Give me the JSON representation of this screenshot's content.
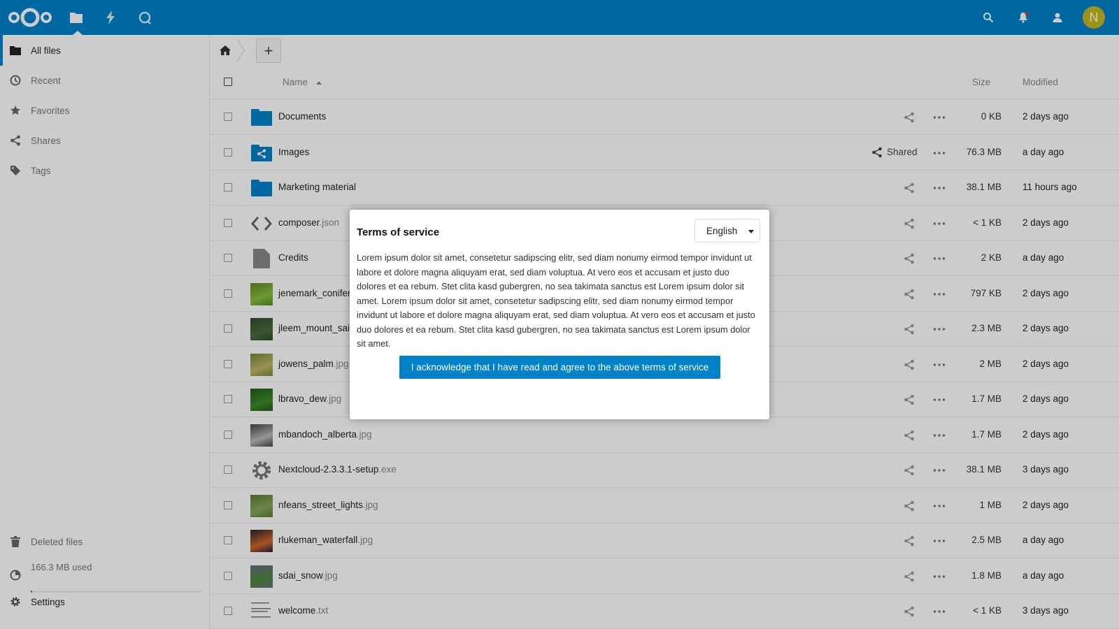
{
  "header": {
    "apps": [
      "files-app",
      "activity-app",
      "talk-app"
    ],
    "avatar_initial": "N",
    "accent_color": "#0082c9"
  },
  "sidebar": {
    "items": [
      {
        "label": "All files",
        "icon": "folder-icon"
      },
      {
        "label": "Recent",
        "icon": "clock-icon"
      },
      {
        "label": "Favorites",
        "icon": "star-icon"
      },
      {
        "label": "Shares",
        "icon": "share-icon"
      },
      {
        "label": "Tags",
        "icon": "tag-icon"
      }
    ],
    "deleted_files": "Deleted files",
    "quota": "166.3 MB used",
    "settings": "Settings"
  },
  "table": {
    "headers": {
      "name": "Name",
      "size": "Size",
      "modified": "Modified"
    },
    "rows": [
      {
        "name": "Documents",
        "ext": "",
        "type": "folder",
        "size": "0 KB",
        "modified": "2 days ago"
      },
      {
        "name": "Images",
        "ext": "",
        "type": "shared-folder",
        "shared_label": "Shared",
        "size": "76.3 MB",
        "modified": "a day ago"
      },
      {
        "name": "Marketing material",
        "ext": "",
        "type": "folder",
        "size": "38.1 MB",
        "modified": "11 hours ago"
      },
      {
        "name": "composer",
        "ext": ".json",
        "type": "code",
        "size": "< 1 KB",
        "modified": "2 days ago"
      },
      {
        "name": "Credits",
        "ext": "",
        "type": "file",
        "size": "2 KB",
        "modified": "a day ago"
      },
      {
        "name": "jenemark_conifer",
        "ext": "",
        "type": "photo",
        "size": "797 KB",
        "modified": "2 days ago"
      },
      {
        "name": "jleem_mount_sai",
        "ext": "",
        "type": "photo",
        "size": "2.3 MB",
        "modified": "2 days ago"
      },
      {
        "name": "jowens_palm",
        "ext": ".jpg",
        "type": "photo",
        "size": "2 MB",
        "modified": "2 days ago"
      },
      {
        "name": "lbravo_dew",
        "ext": ".jpg",
        "type": "photo",
        "size": "1.7 MB",
        "modified": "2 days ago"
      },
      {
        "name": "mbandoch_alberta",
        "ext": ".jpg",
        "type": "photo",
        "size": "1.7 MB",
        "modified": "2 days ago"
      },
      {
        "name": "Nextcloud-2.3.3.1-setup",
        "ext": ".exe",
        "type": "exe",
        "size": "38.1 MB",
        "modified": "3 days ago"
      },
      {
        "name": "nfeans_street_lights",
        "ext": ".jpg",
        "type": "photo",
        "size": "1 MB",
        "modified": "2 days ago"
      },
      {
        "name": "rlukeman_waterfall",
        "ext": ".jpg",
        "type": "photo",
        "size": "2.5 MB",
        "modified": "a day ago"
      },
      {
        "name": "sdai_snow",
        "ext": ".jpg",
        "type": "photo",
        "size": "1.8 MB",
        "modified": "a day ago"
      },
      {
        "name": "welcome",
        "ext": ".txt",
        "type": "text",
        "size": "< 1 KB",
        "modified": "3 days ago"
      }
    ]
  },
  "modal": {
    "title": "Terms of service",
    "language": "English",
    "body": "Lorem ipsum dolor sit amet, consetetur sadipscing elitr, sed diam nonumy eirmod tempor invidunt ut labore et dolore magna aliquyam erat, sed diam voluptua. At vero eos et accusam et justo duo dolores et ea rebum. Stet clita kasd gubergren, no sea takimata sanctus est Lorem ipsum dolor sit amet. Lorem ipsum dolor sit amet, consetetur sadipscing elitr, sed diam nonumy eirmod tempor invidunt ut labore et dolore magna aliquyam erat, sed diam voluptua. At vero eos et accusam et justo duo dolores et ea rebum. Stet clita kasd gubergren, no sea takimata sanctus est Lorem ipsum dolor sit amet.",
    "button": "I acknowledge that I have read and agree to the above terms of service"
  }
}
